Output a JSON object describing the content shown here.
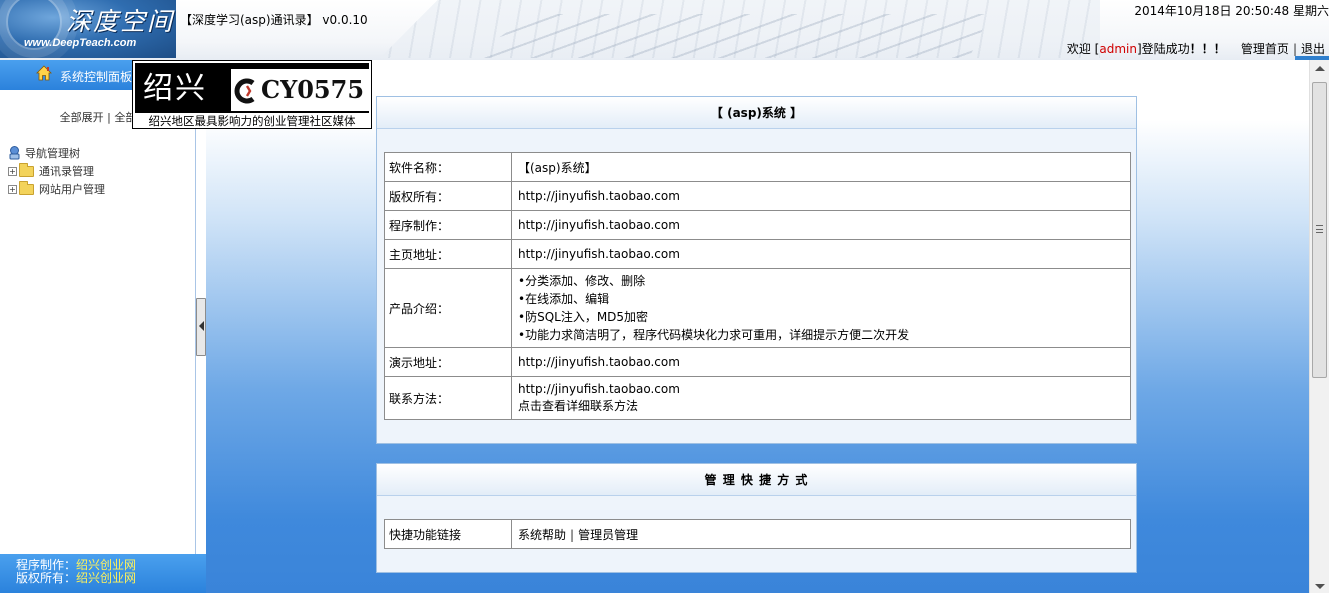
{
  "header": {
    "logo_cn": "深度空间",
    "logo_en": "www.DeepTeach.com",
    "app_title": "【深度学习(asp)通讯录】 v0.0.10",
    "datetime": "2014年10月18日 20:50:48 星期六",
    "welcome_prefix": "欢迎 [",
    "username": "admin",
    "welcome_suffix": "]登陆成功",
    "exclaim": "！！！",
    "nav_home": "管理首页",
    "nav_sep": "|",
    "nav_logout": "退出"
  },
  "sidebar": {
    "panel_title": "系统控制面板",
    "expand_text": "全部展开 | 全部",
    "tree_root": "导航管理树",
    "tree_items": [
      "通讯录管理",
      "网站用户管理"
    ],
    "footer_author_label": "程序制作：",
    "footer_author_value": "绍兴创业网",
    "footer_copy_label": "版权所有：",
    "footer_copy_value": "绍兴创业网"
  },
  "banner": {
    "city": "绍兴",
    "brand": "CY0575",
    "slogan": "绍兴地区最具影响力的创业管理社区媒体"
  },
  "system_card": {
    "title": "【 (asp)系统 】",
    "rows": [
      {
        "label": "软件名称：",
        "value": "【(asp)系统】"
      },
      {
        "label": "版权所有：",
        "value": "http://jinyufish.taobao.com"
      },
      {
        "label": "程序制作：",
        "value": "http://jinyufish.taobao.com"
      },
      {
        "label": "主页地址：",
        "value": "http://jinyufish.taobao.com"
      },
      {
        "label": "产品介绍：",
        "bullets": [
          "•分类添加、修改、删除",
          "•在线添加、编辑",
          "•防SQL注入，MD5加密",
          "•功能力求简洁明了，程序代码模块化力求可重用，详细提示方便二次开发"
        ]
      },
      {
        "label": "演示地址：",
        "value": "http://jinyufish.taobao.com"
      },
      {
        "label": "联系方法：",
        "value": "http://jinyufish.taobao.com",
        "value2": "点击查看详细联系方法"
      }
    ]
  },
  "shortcut_card": {
    "title": "管 理 快 捷 方 式",
    "label": "快捷功能链接",
    "link_help": "系统帮助",
    "link_sep": "|",
    "link_admin": "管理员管理"
  }
}
